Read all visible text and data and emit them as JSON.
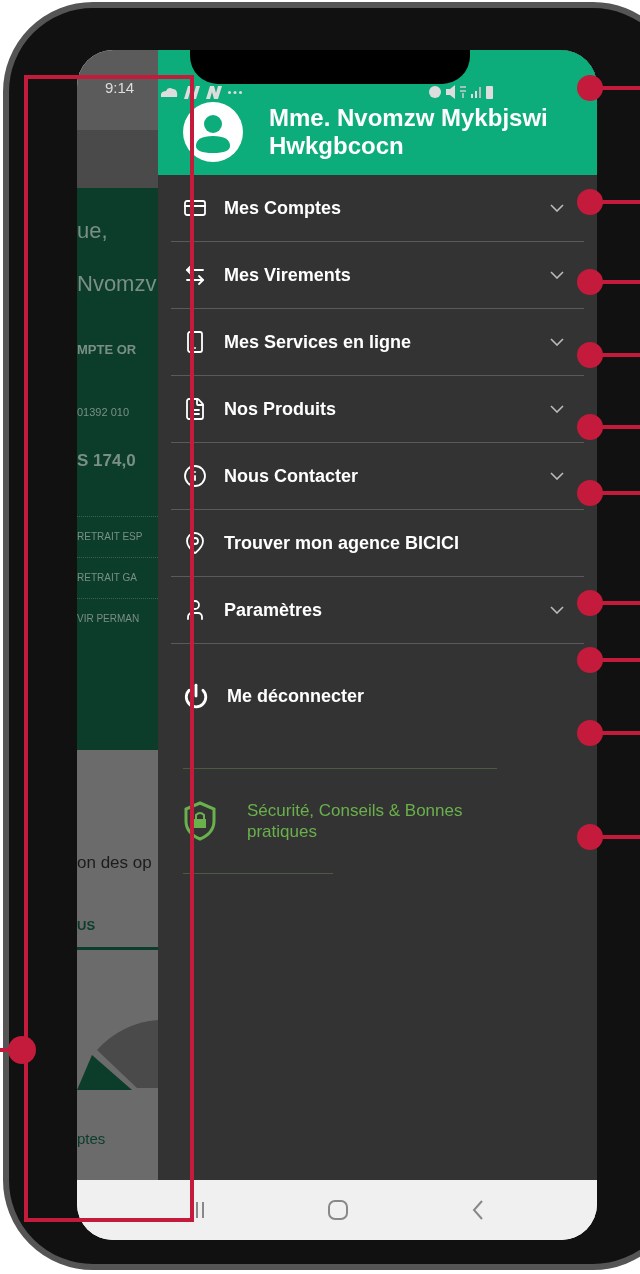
{
  "status_bar": {
    "time": "9:14"
  },
  "background_screen": {
    "greeting": "ue,",
    "name": "Nvomzv",
    "account_type": "MPTE OR",
    "account_number": "01392  010",
    "balance": "S 174,0",
    "operations": [
      "RETRAIT ESP",
      "RETRAIT GA",
      "VIR PERMAN"
    ],
    "section_title": "on des op",
    "tab": "US",
    "legend": "ptes"
  },
  "drawer": {
    "user_name": "Mme. Nvomzw Mykbjswi Hwkgbcocn",
    "items": [
      {
        "kind": "expandable",
        "label": "Mes Comptes",
        "expanded": false
      },
      {
        "kind": "expandable",
        "label": "Mes Virements",
        "expanded": false
      },
      {
        "kind": "expandable",
        "label": "Mes Services en ligne",
        "expanded": false
      },
      {
        "kind": "expandable",
        "label": "Nos Produits",
        "expanded": false
      },
      {
        "kind": "expandable",
        "label": "Nous Contacter",
        "expanded": false
      },
      {
        "kind": "link",
        "label": "Trouver mon agence BICICI"
      },
      {
        "kind": "expandable",
        "label": "Paramètres",
        "expanded": false
      }
    ],
    "logout": "Me déconnecter",
    "footer_link": "Sécurité, Conseils & Bonnes pratiques"
  }
}
